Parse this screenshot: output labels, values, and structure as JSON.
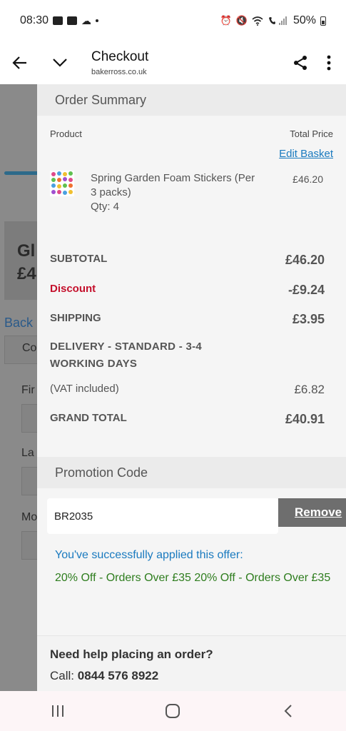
{
  "status_bar": {
    "time": "08:30",
    "battery": "50%"
  },
  "browser": {
    "title": "Checkout",
    "url": "bakerross.co.uk",
    "icons": [
      "back-arrow-icon",
      "chevron-down-icon",
      "share-icon",
      "more-vert-icon"
    ]
  },
  "background_page": {
    "heading_line1": "Gl",
    "heading_line2": "£4",
    "back_link": "Back",
    "field_co": "Co",
    "label_first": "Fir",
    "label_last": "La",
    "label_mobile": "Mo"
  },
  "order_summary": {
    "title": "Order Summary",
    "col_product": "Product",
    "col_total": "Total Price",
    "edit_basket": "Edit Basket",
    "item": {
      "name": "Spring Garden Foam Stickers (Per 3 packs)",
      "qty": "Qty: 4",
      "price": "£46.20"
    },
    "subtotal_label": "SUBTOTAL",
    "subtotal_value": "£46.20",
    "discount_label": "Discount",
    "discount_value": "-£9.24",
    "shipping_label": "SHIPPING",
    "shipping_value": "£3.95",
    "delivery_label": "DELIVERY - STANDARD - 3-4 WORKING DAYS",
    "vat_label": "(VAT included)",
    "vat_value": "£6.82",
    "grand_total_label": "GRAND TOTAL",
    "grand_total_value": "£40.91"
  },
  "promotion": {
    "title": "Promotion Code",
    "code_value": "BR2035",
    "remove_label": "Remove",
    "success_message": "You've successfully applied this offer:",
    "offer_detail": "20% Off - Orders Over £35 20% Off - Orders Over £35"
  },
  "help": {
    "title": "Need help placing an order?",
    "call_label": "Call:",
    "phone": "0844 576 8922"
  },
  "nav_bar": {
    "icons": [
      "recent-apps-icon",
      "home-icon",
      "back-icon"
    ]
  },
  "colors": {
    "link": "#1a7abf",
    "discount": "#c4102c",
    "success_text": "#2e7d1e"
  }
}
